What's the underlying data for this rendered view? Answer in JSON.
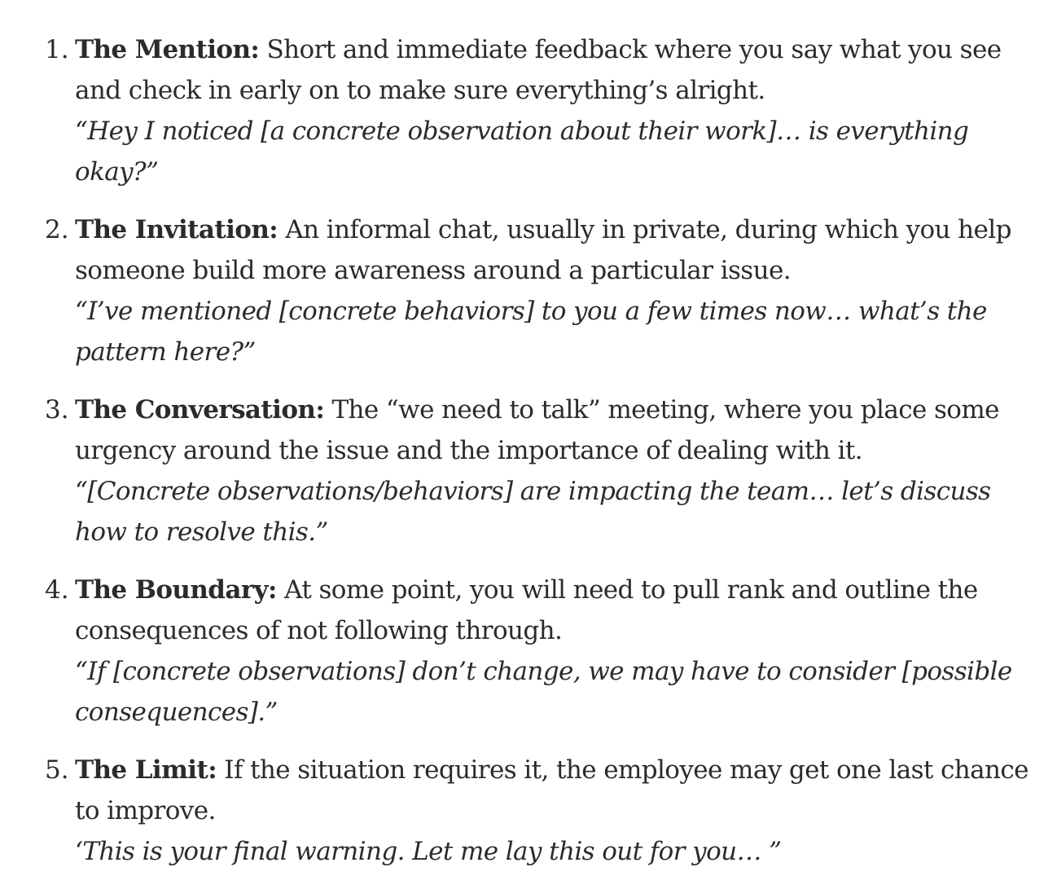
{
  "items": [
    {
      "number": "1.",
      "term": "The Mention:",
      "description": " Short and immediate feedback where you say what you see and check in early on to make sure everything’s alright.",
      "quote": "“Hey I noticed [a concrete observation about their work]… is everything okay?”"
    },
    {
      "number": "2.",
      "term": "The Invitation:",
      "description": " An informal chat, usually in private, during which you help someone build more awareness around a particular issue.",
      "quote": "“I’ve mentioned [concrete behaviors] to you a few times now… what’s the pattern here?”"
    },
    {
      "number": "3.",
      "term": "The Conversation:",
      "description": " The “we need to talk” meeting, where you place some urgency around the issue and the importance of dealing with it.",
      "quote": "“[Concrete observations/behaviors] are impacting the team… let’s discuss how to resolve this.”"
    },
    {
      "number": "4.",
      "term": "The Boundary:",
      "description": " At some point, you will need to pull rank and outline the consequences of not following through.",
      "quote": "“If [concrete observations] don’t change, we may have to consider [possible consequences].”"
    },
    {
      "number": "5.",
      "term": "The Limit:",
      "description": " If the situation requires it, the employee may get one last chance to improve.",
      "quote": "‘This is your final warning. Let me lay this out for you… ”"
    }
  ]
}
